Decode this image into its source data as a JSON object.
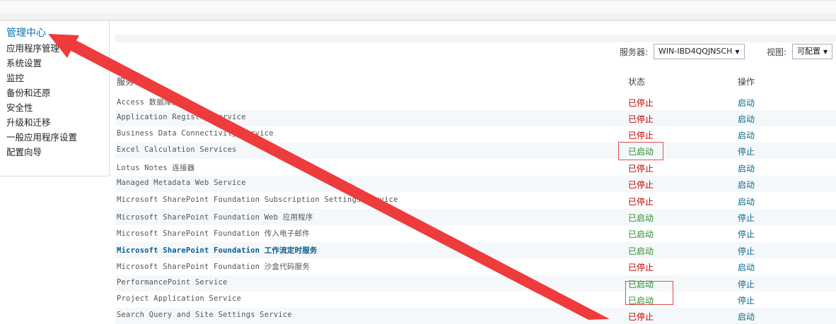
{
  "nav": {
    "title": "管理中心",
    "items": [
      {
        "label": "应用程序管理"
      },
      {
        "label": "系统设置"
      },
      {
        "label": "监控"
      },
      {
        "label": "备份和还原"
      },
      {
        "label": "安全性"
      },
      {
        "label": "升级和迁移"
      },
      {
        "label": "一般应用程序设置"
      },
      {
        "label": "配置向导"
      }
    ]
  },
  "filters": {
    "server_label": "服务器:",
    "server_value": "WIN-IBD4QQJNSCH",
    "view_label": "视图:",
    "view_value": "可配置"
  },
  "table": {
    "headers": {
      "service": "服务",
      "status": "状态",
      "action": "操作"
    },
    "rows": [
      {
        "service": "Access 数据库服务",
        "status": "已停止",
        "action": "启动"
      },
      {
        "service": "Application Registry Service",
        "status": "已停止",
        "action": "启动"
      },
      {
        "service": "Business Data Connectivity Service",
        "status": "已停止",
        "action": "启动"
      },
      {
        "service": "Excel Calculation Services",
        "status": "已启动",
        "action": "停止"
      },
      {
        "service": "Lotus Notes 连接器",
        "status": "已停止",
        "action": "启动"
      },
      {
        "service": "Managed Metadata Web Service",
        "status": "已停止",
        "action": "启动"
      },
      {
        "service": "Microsoft SharePoint Foundation Subscription Settings Service",
        "status": "已停止",
        "action": "启动"
      },
      {
        "service": "Microsoft SharePoint Foundation Web 应用程序",
        "status": "已启动",
        "action": "停止"
      },
      {
        "service": "Microsoft SharePoint Foundation 传入电子邮件",
        "status": "已启动",
        "action": "停止"
      },
      {
        "service": "Microsoft SharePoint Foundation 工作流定时服务",
        "status": "已启动",
        "action": "停止"
      },
      {
        "service": "Microsoft SharePoint Foundation 沙盒代码服务",
        "status": "已停止",
        "action": "启动"
      },
      {
        "service": "PerformancePoint Service",
        "status": "已启动",
        "action": "停止"
      },
      {
        "service": "Project Application Service",
        "status": "已启动",
        "action": "停止"
      },
      {
        "service": "Search Query and Site Settings Service",
        "status": "已停止",
        "action": "启动"
      }
    ]
  },
  "colors": {
    "stopped": "#c00000",
    "started": "#2e8b2e",
    "link": "#0a6a8a",
    "annotation": "#ee3b3b"
  }
}
